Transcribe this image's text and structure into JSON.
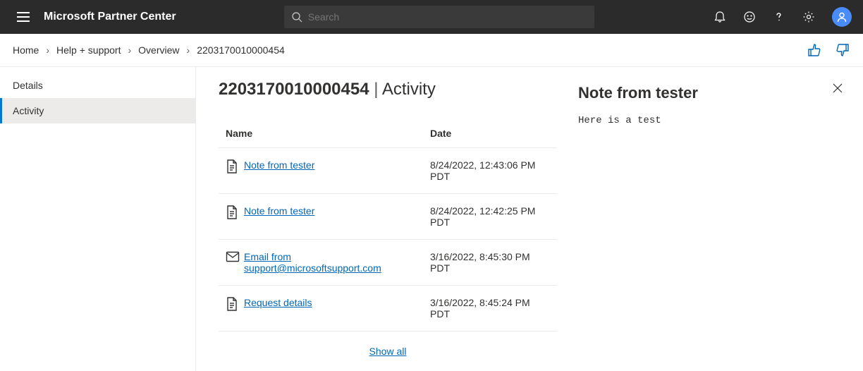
{
  "header": {
    "brand": "Microsoft Partner Center",
    "search_placeholder": "Search"
  },
  "breadcrumb": {
    "home": "Home",
    "help": "Help + support",
    "overview": "Overview",
    "ticket": "2203170010000454"
  },
  "sidebar": {
    "details": "Details",
    "activity": "Activity"
  },
  "page": {
    "ticket_id": "2203170010000454",
    "section": "Activity"
  },
  "table": {
    "col_name": "Name",
    "col_date": "Date",
    "rows": [
      {
        "icon": "doc",
        "label": "Note from tester",
        "date": "8/24/2022, 12:43:06 PM PDT"
      },
      {
        "icon": "doc",
        "label": "Note from tester",
        "date": "8/24/2022, 12:42:25 PM PDT"
      },
      {
        "icon": "mail",
        "label": "Email from support@microsoftsupport.com",
        "date": "3/16/2022, 8:45:30 PM PDT"
      },
      {
        "icon": "doc",
        "label": "Request details",
        "date": "3/16/2022, 8:45:24 PM PDT"
      }
    ],
    "show_all": "Show all"
  },
  "detail": {
    "title": "Note from tester",
    "body": "Here is a test"
  }
}
